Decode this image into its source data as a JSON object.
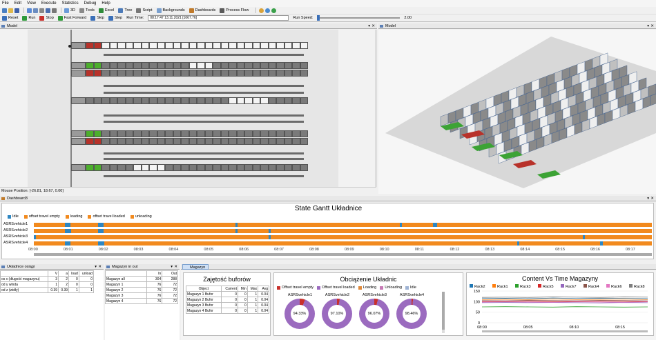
{
  "menu": [
    "File",
    "Edit",
    "View",
    "Execute",
    "Statistics",
    "Debug",
    "Help"
  ],
  "toolbar1": {
    "items": [
      "3D",
      "Tools",
      "Excel",
      "Tree",
      "Script",
      "Backgrounds",
      "Dashboards",
      "Process Flow"
    ]
  },
  "toolbar2": {
    "reset": "Reset",
    "run": "Run",
    "stop": "Stop",
    "fast_forward": "Fast Forward",
    "skip": "Skip",
    "step": "Step",
    "run_time_label": "Run Time:",
    "run_time_value": "08:17:47  13.11.2021  [1067.76]",
    "run_speed_label": "Run Speed:",
    "run_speed_value": "2.00",
    "run_speed_fraction": 0.0
  },
  "model_left": {
    "title": "Model",
    "mouse_position": "Mouse Position: [-26.81, 18.67, 0.00]"
  },
  "model_right": {
    "title": "Model"
  },
  "dashboard_tab": "Dashboard3",
  "gantt": {
    "title": "State Gantt Układnice",
    "legend": [
      {
        "label": "Idle",
        "color": "#2e86c1"
      },
      {
        "label": "offset travel empty",
        "color": "#f28a1e"
      },
      {
        "label": "loading",
        "color": "#f28a1e"
      },
      {
        "label": "offset travel loaded",
        "color": "#f28a1e"
      },
      {
        "label": "unloading",
        "color": "#f28a1e"
      }
    ],
    "rows": [
      "ASRSvehicle1",
      "ASRSvehicle2",
      "ASRSvehicle3",
      "ASRSvehicle4"
    ],
    "ticks": [
      "08:00",
      "08:01",
      "08:02",
      "08:03",
      "08:04",
      "08:05",
      "08:06",
      "08:07",
      "08:08",
      "08:09",
      "08:10",
      "08:11",
      "08:12",
      "08:13",
      "08:14",
      "08:15",
      "08:16",
      "08:17"
    ]
  },
  "panel_uklad": {
    "title": "Układnice osiągi",
    "headers": [
      "",
      "V",
      "a",
      "load",
      "unload"
    ],
    "rows": [
      [
        "os x (długość magazynu)",
        "3",
        "2",
        "0",
        "0"
      ],
      [
        "od y winda",
        "1",
        "2",
        "0",
        "0"
      ],
      [
        "od z (widły)",
        "0.39",
        "0.39",
        "1",
        "1"
      ]
    ]
  },
  "panel_mag": {
    "title": "Magazyn in out",
    "headers": [
      "",
      "In",
      "Out"
    ],
    "rows": [
      [
        "Magazyn all",
        "304",
        "288"
      ],
      [
        "Magazyn 1",
        "76",
        "72"
      ],
      [
        "Magazyn 2",
        "76",
        "72"
      ],
      [
        "Magazyn 3",
        "76",
        "72"
      ],
      [
        "Magazyn 4",
        "76",
        "72"
      ]
    ]
  },
  "magazyn_tab": "Magazyn",
  "bufory": {
    "title": "Zajętość buforów",
    "headers": [
      "Object",
      "Current",
      "Min",
      "Max",
      "Avg"
    ],
    "rows": [
      [
        "Magazyn 1 Bufor",
        "0",
        "0",
        "1",
        "0.04"
      ],
      [
        "Magazyn 2 Bufor",
        "0",
        "0",
        "1",
        "0.04"
      ],
      [
        "Magazyn 3 Bufor",
        "0",
        "0",
        "1",
        "0.04"
      ],
      [
        "Magazyn 4 Bufor",
        "0",
        "0",
        "1",
        "0.04"
      ]
    ]
  },
  "obciazenie": {
    "title": "Obciążenie Układnic",
    "legend": [
      {
        "label": "Offset travel empty",
        "color": "#c8302c"
      },
      {
        "label": "Offset travel loaded",
        "color": "#9b6bbf"
      },
      {
        "label": "Loading",
        "color": "#e08a3c"
      },
      {
        "label": "Unloading",
        "color": "#c77ab5"
      },
      {
        "label": "Idle",
        "color": "#9fb3d4"
      }
    ],
    "donuts": [
      {
        "name": "ASRSvehicle1",
        "value": "94.33%",
        "fraction": 0.9433
      },
      {
        "name": "ASRSvehicle2",
        "value": "97.10%",
        "fraction": 0.971
      },
      {
        "name": "ASRSvehicle3",
        "value": "96.07%",
        "fraction": 0.9607
      },
      {
        "name": "ASRSvehicle4",
        "value": "98.46%",
        "fraction": 0.9846
      }
    ]
  },
  "chart_data": {
    "type": "line",
    "title": "Content Vs Time Magazyny",
    "xlabel": "",
    "ylabel": "",
    "x_ticks": [
      "08:00",
      "08:05",
      "08:10",
      "08:15"
    ],
    "y_ticks": [
      0,
      50,
      100,
      150
    ],
    "ylim": [
      0,
      150
    ],
    "legend_position": "top",
    "series": [
      {
        "name": "Rack2",
        "color": "#1f77b4",
        "values": [
          115,
          116,
          114,
          117,
          115,
          116,
          115,
          114
        ]
      },
      {
        "name": "Rack1",
        "color": "#ff7f0e",
        "values": [
          110,
          111,
          110,
          112,
          110,
          111,
          112,
          110
        ]
      },
      {
        "name": "Rack3",
        "color": "#2ca02c",
        "values": [
          75,
          76,
          75,
          74,
          76,
          75,
          74,
          75
        ]
      },
      {
        "name": "Rack5",
        "color": "#d62728",
        "values": [
          100,
          101,
          102,
          100,
          101,
          102,
          101,
          100
        ]
      },
      {
        "name": "Rack7",
        "color": "#9467bd",
        "values": [
          95,
          96,
          95,
          96,
          95,
          94,
          96,
          95
        ]
      },
      {
        "name": "Rack4",
        "color": "#8c564b",
        "values": [
          105,
          104,
          106,
          105,
          104,
          106,
          105,
          104
        ]
      },
      {
        "name": "Rack6",
        "color": "#e377c2",
        "values": [
          98,
          99,
          98,
          97,
          99,
          98,
          97,
          99
        ]
      },
      {
        "name": "Rack8",
        "color": "#7f7f7f",
        "values": [
          120,
          121,
          120,
          122,
          121,
          120,
          122,
          121
        ]
      }
    ]
  }
}
